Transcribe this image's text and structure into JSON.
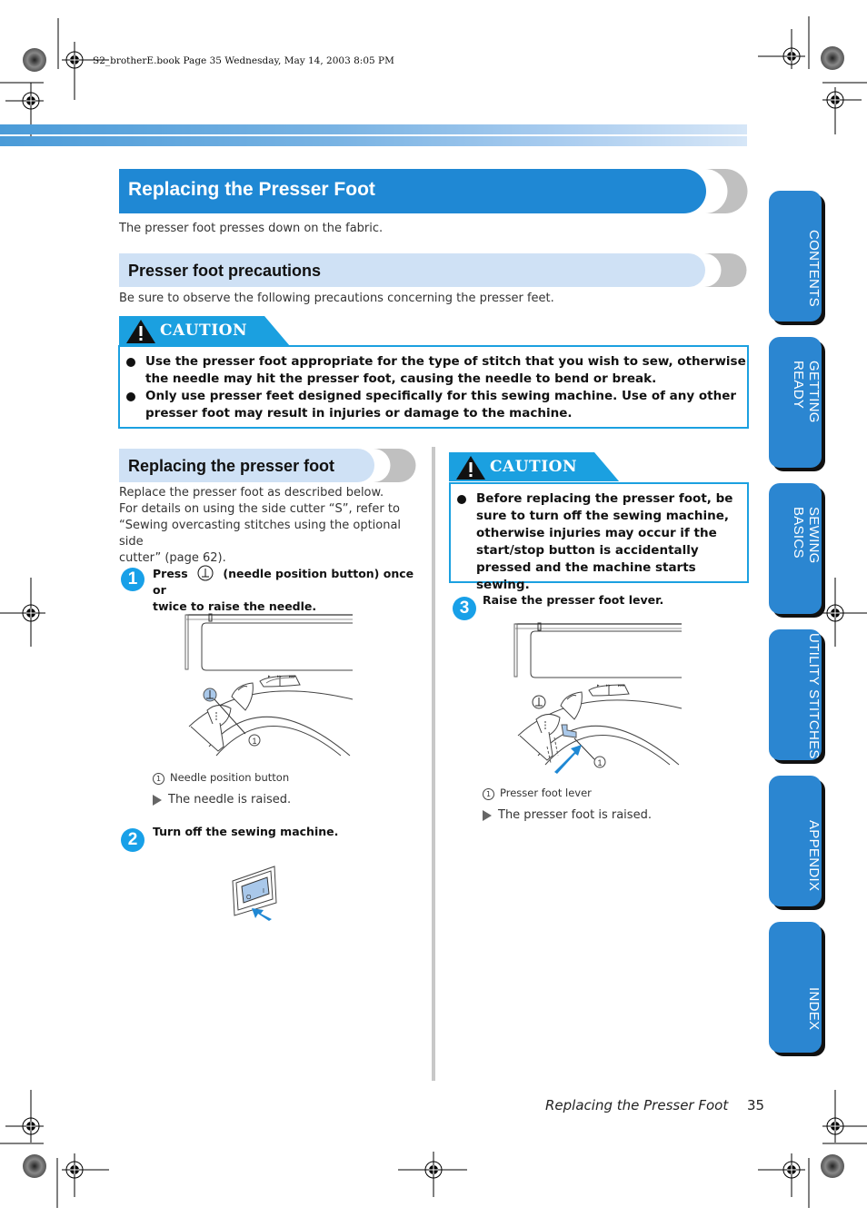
{
  "print_header": "S2_brotherE.book  Page 35  Wednesday, May 14, 2003  8:05 PM",
  "colors": {
    "heading_blue": "#1f88d4",
    "subheading_bg": "#cfe1f5",
    "caution_cyan": "#1ba0e0",
    "tab_blue": "#2b86d1",
    "highlight_blue": "#a9c8ea"
  },
  "page_title": "Replacing the Presser Foot",
  "intro": "The presser foot presses down on the fabric.",
  "precautions": {
    "heading": "Presser foot precautions",
    "intro": "Be sure to observe the following precautions concerning the presser feet.",
    "caution_label": "CAUTION",
    "items": [
      "Use the presser foot appropriate for the type of stitch that you wish to sew, otherwise the needle may hit the presser foot, causing the needle to bend or break.",
      "Only use presser feet designed specifically for this sewing machine. Use of any other presser foot may result in injuries or damage to the machine."
    ]
  },
  "replacing": {
    "heading": "Replacing the presser foot",
    "intro_lines": [
      "Replace the presser foot as described below.",
      "For details on using the side cutter “S”, refer to",
      "“Sewing overcasting stitches using the optional side",
      "cutter” (page 62)."
    ],
    "steps": [
      {
        "number": "1",
        "text_pre": "Press",
        "text_post": "(needle position button) once or",
        "text_line2": "twice to raise the needle.",
        "callout": "1",
        "caption": "Needle position button",
        "result": "The needle is raised."
      },
      {
        "number": "2",
        "text": "Turn off the sewing machine.",
        "switch_off": "O",
        "switch_on": "I"
      },
      {
        "number": "3",
        "text": "Raise the presser foot lever.",
        "callout": "1",
        "caption": "Presser foot lever",
        "result": "The presser foot is raised."
      }
    ],
    "caution_label": "CAUTION",
    "caution_items": [
      "Before replacing the presser foot, be sure to turn off the sewing machine, otherwise injuries may occur if the start/stop button is accidentally pressed and the machine starts sewing."
    ],
    "speed_labels": [
      "▸",
      "▸▸",
      "▸▸▸"
    ]
  },
  "side_tabs": [
    {
      "label": "CONTENTS"
    },
    {
      "label": "GETTING READY"
    },
    {
      "label": "SEWING BASICS"
    },
    {
      "label": "UTILITY STITCHES"
    },
    {
      "label": "APPENDIX"
    },
    {
      "label": "INDEX"
    }
  ],
  "footer": {
    "section": "Replacing the Presser Foot",
    "page_number": "35"
  }
}
